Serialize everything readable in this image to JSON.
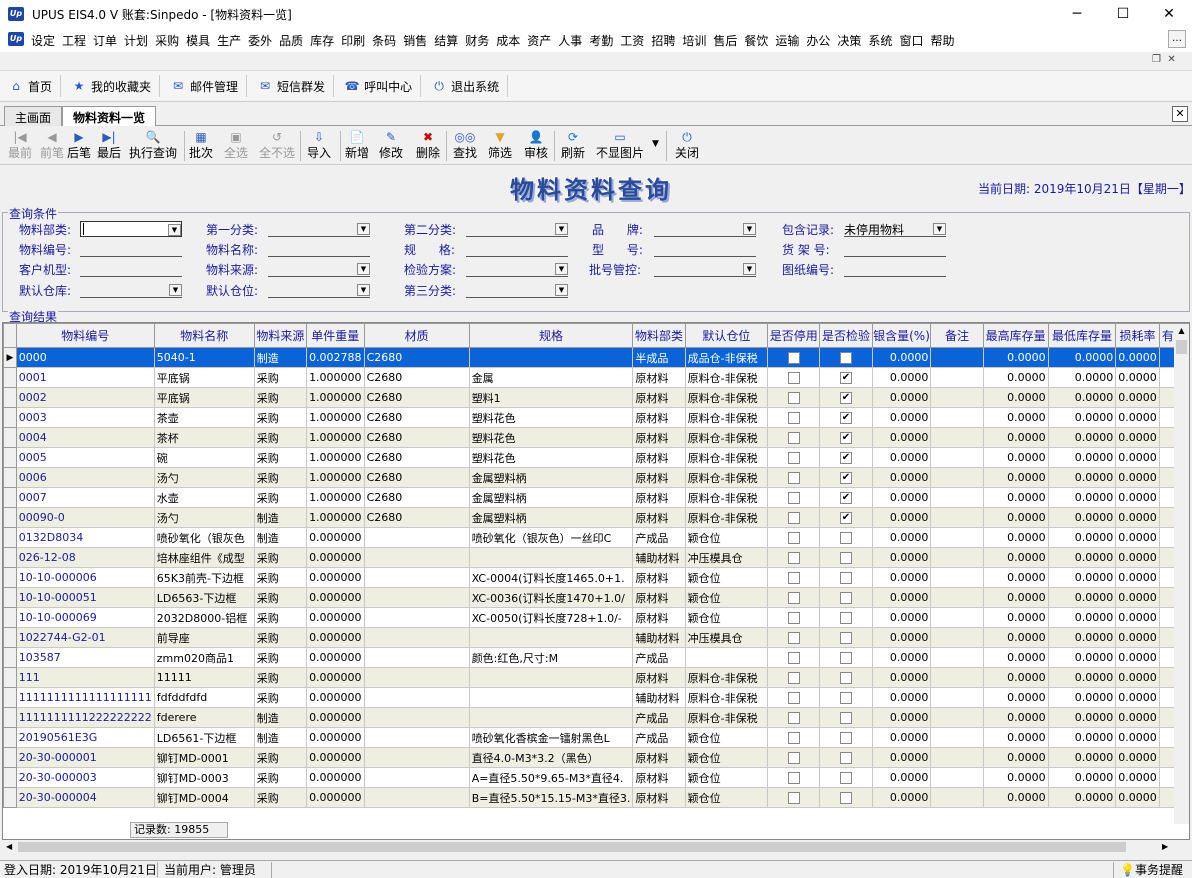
{
  "window": {
    "title": "UPUS EIS4.0 V 账套:Sinpedo - [物料资料一览]",
    "app_icon": "up-logo-icon",
    "minimize": "─",
    "maximize": "☐",
    "close": "✕"
  },
  "menu": [
    "设定",
    "工程",
    "订单",
    "计划",
    "采购",
    "模具",
    "生产",
    "委外",
    "品质",
    "库存",
    "印刷",
    "条码",
    "销售",
    "结算",
    "财务",
    "成本",
    "资产",
    "人事",
    "考勤",
    "工资",
    "招聘",
    "培训",
    "售后",
    "餐饮",
    "运输",
    "办公",
    "决策",
    "系统",
    "窗口",
    "帮助"
  ],
  "quickbar": [
    {
      "label": "首页",
      "icon": "home-icon"
    },
    {
      "label": "我的收藏夹",
      "icon": "favorites-icon"
    },
    {
      "label": "邮件管理",
      "icon": "mail-icon"
    },
    {
      "label": "短信群发",
      "icon": "sms-icon"
    },
    {
      "label": "呼叫中心",
      "icon": "phone-icon"
    },
    {
      "label": "退出系统",
      "icon": "power-icon"
    }
  ],
  "tabs": [
    {
      "label": "主画面",
      "active": false
    },
    {
      "label": "物料资料一览",
      "active": true
    }
  ],
  "toolbar": [
    {
      "label": "最前",
      "icon": "first-icon",
      "enabled": false
    },
    {
      "label": "前笔",
      "icon": "prev-icon",
      "enabled": false
    },
    {
      "label": "后笔",
      "icon": "next-icon",
      "enabled": true
    },
    {
      "label": "最后",
      "icon": "last-icon",
      "enabled": true
    },
    {
      "label": "执行查询",
      "icon": "search-icon",
      "enabled": true
    },
    {
      "label": "批次",
      "icon": "batch-icon",
      "enabled": true
    },
    {
      "label": "全选",
      "icon": "select-all-icon",
      "enabled": false
    },
    {
      "label": "全不选",
      "icon": "deselect-all-icon",
      "enabled": false
    },
    {
      "label": "导入",
      "icon": "import-icon",
      "enabled": true
    },
    {
      "label": "新增",
      "icon": "new-icon",
      "enabled": true
    },
    {
      "label": "修改",
      "icon": "edit-icon",
      "enabled": true
    },
    {
      "label": "删除",
      "icon": "delete-icon",
      "enabled": true
    },
    {
      "label": "查找",
      "icon": "binoculars-icon",
      "enabled": true
    },
    {
      "label": "筛选",
      "icon": "filter-icon",
      "enabled": true
    },
    {
      "label": "审核",
      "icon": "audit-icon",
      "enabled": true
    },
    {
      "label": "刷新",
      "icon": "refresh-icon",
      "enabled": true
    },
    {
      "label": "不显图片",
      "icon": "picture-icon",
      "enabled": true
    },
    {
      "label": "关闭",
      "icon": "close-icon",
      "enabled": true
    }
  ],
  "form": {
    "title": "物料资料查询",
    "date_label": "当前日期: 2019年10月21日【星期一】"
  },
  "query": {
    "group_label": "查询条件",
    "fields": {
      "material_dept": {
        "label": "物料部类:",
        "value": ""
      },
      "category1": {
        "label": "第一分类:",
        "value": ""
      },
      "category2": {
        "label": "第二分类:",
        "value": ""
      },
      "brand": {
        "label": "品      牌:",
        "value": ""
      },
      "include": {
        "label": "包含记录:",
        "value": "未停用物料"
      },
      "material_code": {
        "label": "物料编号:",
        "value": ""
      },
      "material_name": {
        "label": "物料名称:",
        "value": ""
      },
      "spec": {
        "label": "规      格:",
        "value": ""
      },
      "model": {
        "label": "型      号:",
        "value": ""
      },
      "shelf": {
        "label": "货 架 号:",
        "value": ""
      },
      "customer_model": {
        "label": "客户机型:",
        "value": ""
      },
      "source": {
        "label": "物料来源:",
        "value": ""
      },
      "inspection": {
        "label": "检验方案:",
        "value": ""
      },
      "lot_control": {
        "label": "批号管控:",
        "value": ""
      },
      "drawing_no": {
        "label": "图纸编号:",
        "value": ""
      },
      "default_wh": {
        "label": "默认仓库:",
        "value": ""
      },
      "default_loc": {
        "label": "默认仓位:",
        "value": ""
      },
      "category3": {
        "label": "第三分类:",
        "value": ""
      }
    }
  },
  "results": {
    "group_label": "查询结果",
    "columns": [
      "物料编号",
      "物料名称",
      "物料来源",
      "单件重量",
      "材质",
      "规格",
      "物料部类",
      "默认仓位",
      "是否停用",
      "是否检验",
      "银含量(%)",
      "备注",
      "最高库存量",
      "最低库存量",
      "损耗率",
      "有效"
    ],
    "rows": [
      [
        "0000",
        "5040-1",
        "制造",
        "0.002788",
        "C2680",
        "",
        "半成品",
        "成品仓-非保税",
        false,
        false,
        "0.0000",
        "",
        "0.0000",
        "0.0000",
        "0.0000"
      ],
      [
        "0001",
        "平底锅",
        "采购",
        "1.000000",
        "C2680",
        "金属",
        "原材料",
        "原料仓-非保税",
        false,
        true,
        "0.0000",
        "",
        "0.0000",
        "0.0000",
        "0.0000"
      ],
      [
        "0002",
        "平底锅",
        "采购",
        "1.000000",
        "C2680",
        "塑料1",
        "原材料",
        "原料仓-非保税",
        false,
        true,
        "0.0000",
        "",
        "0.0000",
        "0.0000",
        "0.0000"
      ],
      [
        "0003",
        "茶壶",
        "采购",
        "1.000000",
        "C2680",
        "塑料花色",
        "原材料",
        "原料仓-非保税",
        false,
        true,
        "0.0000",
        "",
        "0.0000",
        "0.0000",
        "0.0000"
      ],
      [
        "0004",
        "茶杯",
        "采购",
        "1.000000",
        "C2680",
        "塑料花色",
        "原材料",
        "原料仓-非保税",
        false,
        true,
        "0.0000",
        "",
        "0.0000",
        "0.0000",
        "0.0000"
      ],
      [
        "0005",
        "碗",
        "采购",
        "1.000000",
        "C2680",
        "塑料花色",
        "原材料",
        "原料仓-非保税",
        false,
        true,
        "0.0000",
        "",
        "0.0000",
        "0.0000",
        "0.0000"
      ],
      [
        "0006",
        "汤勺",
        "采购",
        "1.000000",
        "C2680",
        "金属塑料柄",
        "原材料",
        "原料仓-非保税",
        false,
        true,
        "0.0000",
        "",
        "0.0000",
        "0.0000",
        "0.0000"
      ],
      [
        "0007",
        "水壶",
        "采购",
        "1.000000",
        "C2680",
        "金属塑料柄",
        "原材料",
        "原料仓-非保税",
        false,
        true,
        "0.0000",
        "",
        "0.0000",
        "0.0000",
        "0.0000"
      ],
      [
        "00090-0",
        "汤勺",
        "制造",
        "1.000000",
        "C2680",
        "金属塑料柄",
        "原材料",
        "原料仓-非保税",
        false,
        true,
        "0.0000",
        "",
        "0.0000",
        "0.0000",
        "0.0000"
      ],
      [
        "0132D8034",
        "喷砂氧化（银灰色",
        "制造",
        "0.000000",
        "",
        "喷砂氧化（银灰色）一丝印C",
        "产成品",
        "颖仓位",
        false,
        false,
        "0.0000",
        "",
        "0.0000",
        "0.0000",
        "0.0000"
      ],
      [
        "026-12-08",
        "培林座组件《成型",
        "采购",
        "0.000000",
        "",
        "",
        "辅助材料",
        "冲压模具仓",
        false,
        false,
        "0.0000",
        "",
        "0.0000",
        "0.0000",
        "0.0000"
      ],
      [
        "10-10-000006",
        "65K3前壳-下边框",
        "采购",
        "0.000000",
        "",
        "XC-0004(订料长度1465.0+1.",
        "原材料",
        "颖仓位",
        false,
        false,
        "0.0000",
        "",
        "0.0000",
        "0.0000",
        "0.0000"
      ],
      [
        "10-10-000051",
        "LD6563-下边框",
        "采购",
        "0.000000",
        "",
        "XC-0036(订料长度1470+1.0/",
        "原材料",
        "颖仓位",
        false,
        false,
        "0.0000",
        "",
        "0.0000",
        "0.0000",
        "0.0000"
      ],
      [
        "10-10-000069",
        "2032D8000-铝框",
        "采购",
        "0.000000",
        "",
        "XC-0050(订料长度728+1.0/-",
        "原材料",
        "颖仓位",
        false,
        false,
        "0.0000",
        "",
        "0.0000",
        "0.0000",
        "0.0000"
      ],
      [
        "1022744-G2-01",
        "前导座",
        "采购",
        "0.000000",
        "",
        "",
        "辅助材料",
        "冲压模具仓",
        false,
        false,
        "0.0000",
        "",
        "0.0000",
        "0.0000",
        "0.0000"
      ],
      [
        "103587",
        "zmm020商品1",
        "采购",
        "0.000000",
        "",
        "颜色:红色,尺寸:M",
        "产成品",
        "",
        false,
        false,
        "0.0000",
        "",
        "0.0000",
        "0.0000",
        "0.0000"
      ],
      [
        "111",
        "11111",
        "采购",
        "0.000000",
        "",
        "",
        "原材料",
        "原料仓-非保税",
        false,
        false,
        "0.0000",
        "",
        "0.0000",
        "0.0000",
        "0.0000"
      ],
      [
        "1111111111111111111",
        "fdfddfdfd",
        "采购",
        "0.000000",
        "",
        "",
        "辅助材料",
        "原料仓-非保税",
        false,
        false,
        "0.0000",
        "",
        "0.0000",
        "0.0000",
        "0.0000"
      ],
      [
        "1111111111222222222",
        "fderere",
        "制造",
        "0.000000",
        "",
        "",
        "产成品",
        "原料仓-非保税",
        false,
        false,
        "0.0000",
        "",
        "0.0000",
        "0.0000",
        "0.0000"
      ],
      [
        "20190561E3G",
        "LD6561-下边框",
        "制造",
        "0.000000",
        "",
        "喷砂氧化香槟金一镭射黑色L",
        "产成品",
        "颖仓位",
        false,
        false,
        "0.0000",
        "",
        "0.0000",
        "0.0000",
        "0.0000"
      ],
      [
        "20-30-000001",
        "铆钉MD-0001",
        "采购",
        "0.000000",
        "",
        "直径4.0-M3*3.2（黑色）",
        "原材料",
        "颖仓位",
        false,
        false,
        "0.0000",
        "",
        "0.0000",
        "0.0000",
        "0.0000"
      ],
      [
        "20-30-000003",
        "铆钉MD-0003",
        "采购",
        "0.000000",
        "",
        "A=直径5.50*9.65-M3*直径4.",
        "原材料",
        "颖仓位",
        false,
        false,
        "0.0000",
        "",
        "0.0000",
        "0.0000",
        "0.0000"
      ],
      [
        "20-30-000004",
        "铆钉MD-0004",
        "采购",
        "0.000000",
        "",
        "B=直径5.50*15.15-M3*直径3.",
        "原材料",
        "颖仓位",
        false,
        false,
        "0.0000",
        "",
        "0.0000",
        "0.0000",
        "0.0000"
      ]
    ],
    "record_count": "记录数: 19855"
  },
  "status": {
    "login_date": "登入日期: 2019年10月21日",
    "current_user": "当前用户: 管理员",
    "reminder": "事务提醒"
  }
}
